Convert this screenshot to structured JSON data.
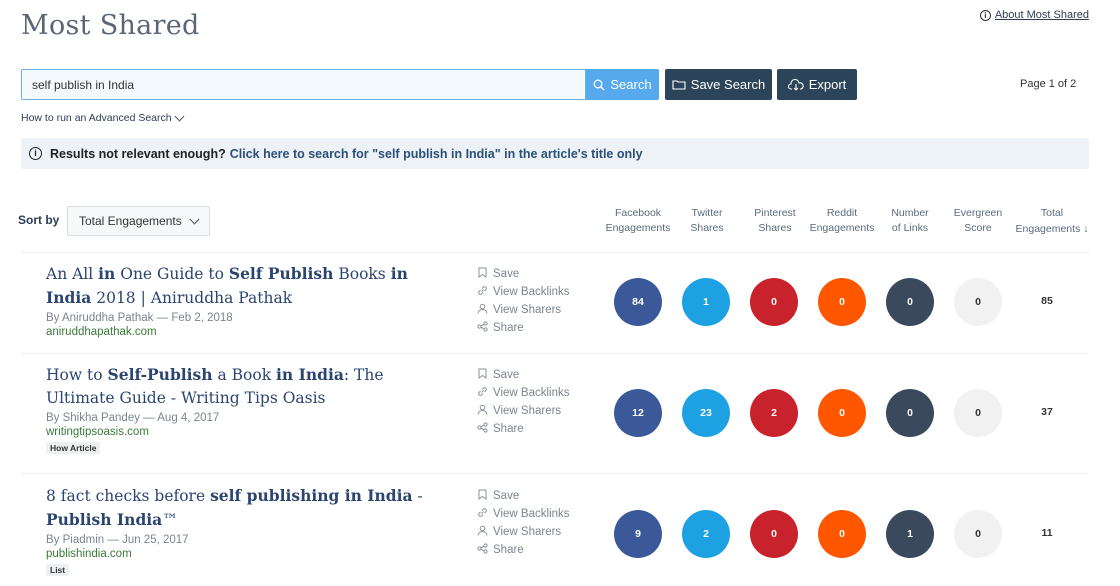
{
  "page": {
    "title": "Most Shared",
    "about_link": "About Most Shared",
    "page_count": "Page 1 of 2"
  },
  "search": {
    "value": "self publish in India",
    "search_label": "Search",
    "save_label": "Save Search",
    "export_label": "Export",
    "advanced_link": "How to run an Advanced Search"
  },
  "notice": {
    "prefix": "Results not relevant enough?",
    "link": "Click here to search for \"self publish in India\" in the article's title only"
  },
  "sort": {
    "label": "Sort by",
    "value": "Total Engagements"
  },
  "columns": [
    {
      "line1": "Facebook",
      "line2": "Engagements"
    },
    {
      "line1": "Twitter",
      "line2": "Shares"
    },
    {
      "line1": "Pinterest",
      "line2": "Shares"
    },
    {
      "line1": "Reddit",
      "line2": "Engagements"
    },
    {
      "line1": "Number",
      "line2": "of Links"
    },
    {
      "line1": "Evergreen",
      "line2": "Score"
    },
    {
      "line1": "Total",
      "line2": "Engagements ↓"
    }
  ],
  "actions": [
    "Save",
    "View Backlinks",
    "View Sharers",
    "Share"
  ],
  "colors": {
    "facebook": "#3b5998",
    "twitter": "#1da1e2",
    "pinterest": "#c8232c",
    "reddit": "#ff5700",
    "links": "#3a4a5c",
    "evergreen": "#f1f1f1"
  },
  "articles": [
    {
      "title_parts": [
        {
          "t": "An All ",
          "b": false
        },
        {
          "t": "in",
          "b": true
        },
        {
          "t": " One Guide to ",
          "b": false
        },
        {
          "t": "Self Publish",
          "b": true
        },
        {
          "t": " Books ",
          "b": false
        },
        {
          "t": "in India",
          "b": true
        },
        {
          "t": " 2018 | Aniruddha Pathak",
          "b": false
        }
      ],
      "author": "By Aniruddha Pathak",
      "date": "Feb 2, 2018",
      "domain": "aniruddhapathak.com",
      "tag": "",
      "facebook": "84",
      "twitter": "1",
      "pinterest": "0",
      "reddit": "0",
      "links": "0",
      "evergreen": "0",
      "total": "85"
    },
    {
      "title_parts": [
        {
          "t": "How to ",
          "b": false
        },
        {
          "t": "Self-Publish",
          "b": true
        },
        {
          "t": " a Book ",
          "b": false
        },
        {
          "t": "in India",
          "b": true
        },
        {
          "t": ": The Ultimate Guide - Writing Tips Oasis",
          "b": false
        }
      ],
      "author": "By Shikha Pandey",
      "date": "Aug 4, 2017",
      "domain": "writingtipsoasis.com",
      "tag": "How Article",
      "facebook": "12",
      "twitter": "23",
      "pinterest": "2",
      "reddit": "0",
      "links": "0",
      "evergreen": "0",
      "total": "37"
    },
    {
      "title_parts": [
        {
          "t": "8 fact checks before ",
          "b": false
        },
        {
          "t": "self publishing in India",
          "b": true
        },
        {
          "t": " - ",
          "b": false
        },
        {
          "t": "Publish India",
          "b": true
        },
        {
          "t": "™",
          "b": false
        }
      ],
      "author": "By Piadmin",
      "date": "Jun 25, 2017",
      "domain": "publishindia.com",
      "tag": "List",
      "facebook": "9",
      "twitter": "2",
      "pinterest": "0",
      "reddit": "0",
      "links": "1",
      "evergreen": "0",
      "total": "11"
    }
  ]
}
